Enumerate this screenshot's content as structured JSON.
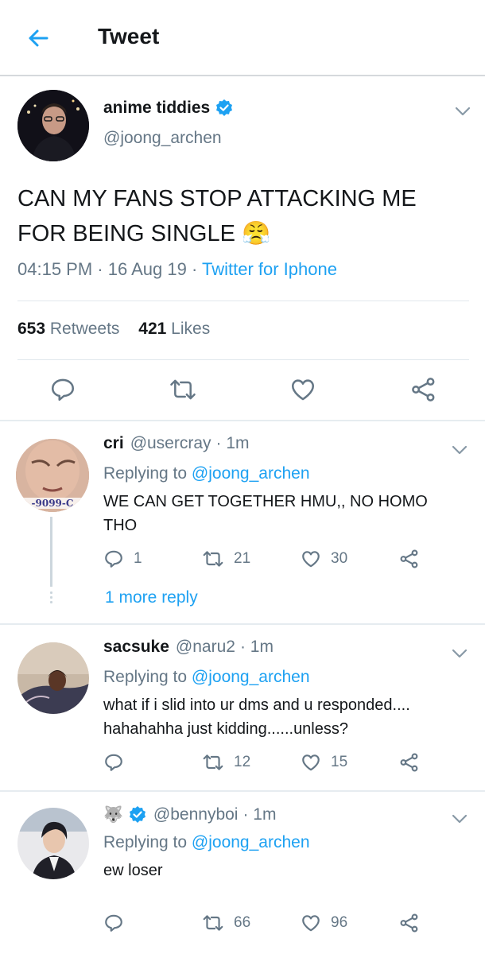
{
  "header": {
    "title": "Tweet"
  },
  "main_tweet": {
    "display_name": "anime tiddies",
    "handle": "@joong_archen",
    "text": "CAN MY FANS STOP ATTACKING ME FOR BEING SINGLE 😤",
    "time": "04:15 PM",
    "sep1": " · ",
    "date": "16 Aug 19",
    "sep2": " · ",
    "source": "Twitter for Iphone",
    "retweets_count": "653",
    "retweets_label": "Retweets",
    "likes_count": "421",
    "likes_label": "Likes"
  },
  "replies": [
    {
      "display_name": "cri",
      "handle": "@usercray",
      "time": "· 1m",
      "replying_prefix": "Replying to",
      "replying_to": "@joong_archen",
      "text": "WE CAN GET TOGETHER HMU,, NO HOMO THO",
      "avatar_text": "-9099-C",
      "reply_count": "1",
      "retweet_count": "21",
      "like_count": "30",
      "more_replies": "1 more reply"
    },
    {
      "display_name": "sacsuke",
      "handle": "@naru2",
      "time": "· 1m",
      "replying_prefix": "Replying to",
      "replying_to": "@joong_archen",
      "text": "what if i slid into ur dms and u responded.... hahahahha just kidding......unless?",
      "reply_count": "",
      "retweet_count": "12",
      "like_count": "15"
    },
    {
      "display_name": "🐺",
      "handle": "@bennyboi",
      "time": "· 1m",
      "replying_prefix": "Replying to",
      "replying_to": "@joong_archen",
      "text": "ew loser",
      "reply_count": "",
      "retweet_count": "66",
      "like_count": "96"
    }
  ],
  "colors": {
    "accent": "#1da1f2",
    "muted": "#657786",
    "text": "#14171a",
    "divider": "#e6ecf0"
  },
  "icons": [
    "back-arrow-icon",
    "chevron-down-icon",
    "reply-icon",
    "retweet-icon",
    "like-icon",
    "share-icon",
    "verified-badge-icon"
  ]
}
